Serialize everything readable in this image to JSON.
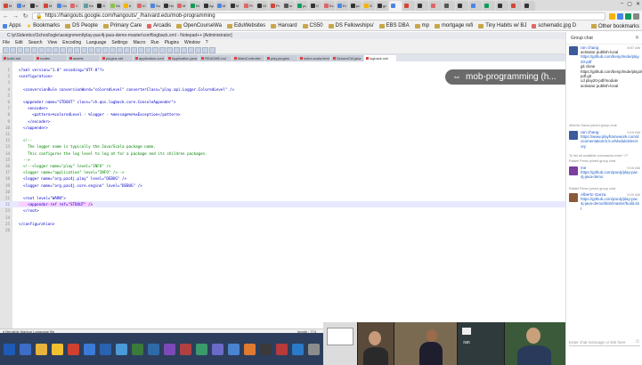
{
  "browser": {
    "tab_count": 40,
    "tab_colors": [
      "#d44638",
      "#4a86e8",
      "#333333",
      "#d44638",
      "#4a86e8",
      "#e06666",
      "#5f9ea0",
      "#333333",
      "#8bc34a",
      "#f4b400",
      "#e06666",
      "#4a86e8",
      "#333333",
      "#e06666",
      "#0f9d58",
      "#333333",
      "#4a86e8",
      "#333333",
      "#e06666",
      "#333333",
      "#d44638",
      "#555555",
      "#0f9d58",
      "#333333",
      "#e06666",
      "#4a86e8",
      "#333333",
      "#f4b400",
      "#333333",
      "#4a86e8",
      "#d44638",
      "#333333",
      "#e06666",
      "#555555",
      "#333333",
      "#4a86e8",
      "#0f9d58",
      "#333333",
      "#d44638",
      "#333333"
    ],
    "tab_labels": [
      "M",
      "M",
      "In",
      "M",
      "Go",
      "C",
      "Ke",
      "G",
      "Sh",
      "6",
      "IC",
      "Su",
      "Ho",
      "M",
      "IN",
      "Ap",
      "M",
      "M",
      "Pr",
      "Gi",
      "Pr",
      "m",
      "pu",
      "G",
      "Ec",
      "Er",
      "pu",
      "G",
      "go"
    ],
    "url": "https://hangouts.google.com/hangouts/_/harvard.edu/mob-programming",
    "window_controls": [
      "–",
      "▢",
      "✕"
    ],
    "bookmarks": [
      {
        "label": "Apps",
        "type": "apps"
      },
      {
        "label": "Bookmarks",
        "type": "star"
      },
      {
        "label": "DS People",
        "type": "folder"
      },
      {
        "label": "Primary Care",
        "type": "folder"
      },
      {
        "label": "Arcadis",
        "type": "site"
      },
      {
        "label": "OpenCourseWa",
        "type": "folder"
      },
      {
        "label": "EduWebsites",
        "type": "folder"
      },
      {
        "label": "Harvard",
        "type": "folder"
      },
      {
        "label": "CS50",
        "type": "folder"
      },
      {
        "label": "DS Fellowships/",
        "type": "folder"
      },
      {
        "label": "EBS DBA",
        "type": "folder"
      },
      {
        "label": "mp",
        "type": "folder"
      },
      {
        "label": "mortgage refi",
        "type": "folder"
      },
      {
        "label": "Tiny Habits w/ BJ",
        "type": "folder"
      },
      {
        "label": "schematic.jpg D",
        "type": "site"
      }
    ],
    "other_bookmarks": "Other bookmarks"
  },
  "hangout": {
    "title": "mob-programming (h..."
  },
  "notepad": {
    "title": "C:\\p\\Sidentics\\School\\sgle\\assignment\\play-pac4j-java-demo-master\\conf\\logback.xml - Notepad++ [Administrator]",
    "menu": [
      "File",
      "Edit",
      "Search",
      "View",
      "Encoding",
      "Language",
      "Settings",
      "Macro",
      "Run",
      "Plugins",
      "Window",
      "?"
    ],
    "file_tabs": [
      "build.sbt",
      "routes",
      "assets",
      "plugins.sbt",
      "application.conf",
      "Application.java",
      "README.md",
      "MainController",
      "play.plugins",
      "index.scala.html",
      "SecureCtrl.java",
      "logback.xml"
    ],
    "status_left": "eXtensible Markup Language file",
    "status_right": "length : 774"
  },
  "code_lines": [
    {
      "n": "1",
      "t": "<?xml version=\"1.0\" encoding=\"UTF-8\"?>",
      "k": "tag"
    },
    {
      "n": "2",
      "t": "<configuration>",
      "k": "tag"
    },
    {
      "n": "3",
      "t": "",
      "k": "tag"
    },
    {
      "n": "4",
      "t": "  <conversionRule conversionWord=\"coloredLevel\" converterClass=\"play.api.Logger.ColoredLevel\" />",
      "k": "tag"
    },
    {
      "n": "5",
      "t": "",
      "k": "tag"
    },
    {
      "n": "6",
      "t": "  <appender name=\"STDOUT\" class=\"ch.qos.logback.core.ConsoleAppender\">",
      "k": "tag"
    },
    {
      "n": "7",
      "t": "    <encoder>",
      "k": "tag"
    },
    {
      "n": "8",
      "t": "      <pattern>%coloredLevel - %logger - %message%n%xException</pattern>",
      "k": "tag"
    },
    {
      "n": "9",
      "t": "    </encoder>",
      "k": "tag"
    },
    {
      "n": "10",
      "t": "  </appender>",
      "k": "tag"
    },
    {
      "n": "11",
      "t": "",
      "k": "tag"
    },
    {
      "n": "12",
      "t": "  <!--",
      "k": "cmt"
    },
    {
      "n": "13",
      "t": "    The logger name is typically the Java/Scala package name.",
      "k": "cmt"
    },
    {
      "n": "14",
      "t": "    This configures the log level to log at for a package and its children packages.",
      "k": "cmt"
    },
    {
      "n": "15",
      "t": "  -->",
      "k": "cmt"
    },
    {
      "n": "16",
      "t": "  <!--<logger name=\"play\" level=\"INFO\" />",
      "k": "cmt"
    },
    {
      "n": "17",
      "t": "  <logger name=\"application\" level=\"INFO\" />-->",
      "k": "cmt"
    },
    {
      "n": "18",
      "t": "  <logger name=\"org.pac4j.play\" level=\"DEBUG\" />",
      "k": "tag"
    },
    {
      "n": "19",
      "t": "  <logger name=\"org.pac4j.core.engine\" level=\"DEBUG\" />",
      "k": "tag"
    },
    {
      "n": "20",
      "t": "",
      "k": "tag"
    },
    {
      "n": "21",
      "t": "  <root level=\"WARN\">",
      "k": "tag"
    },
    {
      "n": "22",
      "t": "    <appender-ref ref=\"STDOUT\" />",
      "k": "sel"
    },
    {
      "n": "23",
      "t": "  </root>",
      "k": "tag"
    },
    {
      "n": "24",
      "t": "",
      "k": "tag"
    },
    {
      "n": "25",
      "t": "</configuration>",
      "k": "tag"
    },
    {
      "n": "26",
      "t": "",
      "k": "tag"
    }
  ],
  "chat": {
    "header": "Group chat",
    "input_placeholder": "Enter chat message or link here",
    "messages": [
      {
        "name": "ran chang",
        "time": "8:57 AM",
        "lines": [
          "activator publish-local",
          "https://github.com/benjohnde/play20-pdf",
          "git clone https://github.com/benjohnde/play20-pdf.git",
          "cd play20-pdf/module",
          "activator publish-local"
        ],
        "avatar_color": "#3b5b9a"
      },
      {
        "name": "ran chang",
        "time": "9:15 AM",
        "lines": [
          "https://www.playframework.com/documentation/2.5.x/ModuleDirectory"
        ],
        "avatar_color": "#3b5b9a"
      },
      {
        "name": "me",
        "time": "9:16 AM",
        "lines": [
          "https://github.com/pac4j/play-pac4j-java-demo"
        ],
        "avatar_color": "#7b3fa0"
      },
      {
        "name": "Alberto Garza",
        "time": "9:20 AM",
        "lines": [
          "https://github.com/pac4j/play-pac4j-java-demo/blob/master/build.sbt"
        ],
        "avatar_color": "#8a5a3a"
      }
    ],
    "system_notes": [
      "Alberto Garza joined group chat",
      "To list all available commands enter \"/?\"",
      "Rafael Perez joined group chat",
      "Rafael Perez joined group chat"
    ]
  },
  "participants": [
    "ran"
  ],
  "taskbar_icon_colors": [
    "#3c6ec8",
    "#e8b33c",
    "#f0c030",
    "#d04030",
    "#3a7ad8",
    "#2a62b0",
    "#4a9ad8",
    "#3a7a3a",
    "#2f6aa8",
    "#7c4ab8",
    "#b04040",
    "#3a9a6a",
    "#6a6ac8",
    "#4a84d0",
    "#e07a30",
    "#3a3a3a",
    "#b83a3a",
    "#2a7ac8",
    "#8c8c8c",
    "#c04a8a",
    "#3a8a8a",
    "#d0a030",
    "#5a5ad0"
  ]
}
